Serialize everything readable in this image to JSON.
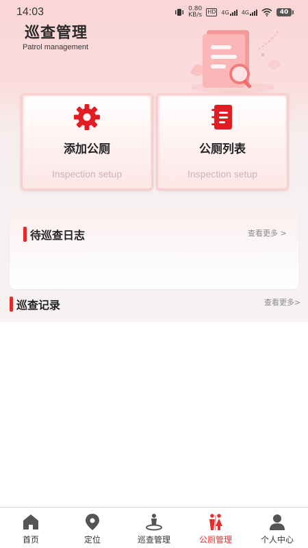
{
  "status_bar": {
    "time": "14:03",
    "speed_value": "0.80",
    "speed_unit": "KB/s",
    "hd_label": "HD",
    "net1": "4G",
    "net2": "4G",
    "battery": "40"
  },
  "header": {
    "title": "巡查管理",
    "subtitle": "Patrol management"
  },
  "cards": [
    {
      "label": "添加公厕",
      "subtitle": "Inspection setup",
      "icon": "gear-icon"
    },
    {
      "label": "公厕列表",
      "subtitle": "Inspection setup",
      "icon": "notebook-icon"
    }
  ],
  "pending_log": {
    "title": "待巡查日志",
    "more": "查看更多 >"
  },
  "records": {
    "title": "巡查记录",
    "more": "查看更多>"
  },
  "tabbar": {
    "items": [
      {
        "label": "首页",
        "icon": "home-icon"
      },
      {
        "label": "定位",
        "icon": "location-pin-icon"
      },
      {
        "label": "巡查管理",
        "icon": "patrol-person-icon"
      },
      {
        "label": "公厕管理",
        "icon": "restroom-icon",
        "active": true
      },
      {
        "label": "个人中心",
        "icon": "user-icon"
      }
    ]
  },
  "colors": {
    "accent": "#e12a2a",
    "active_tab": "#e03030",
    "card_bg": "#fde6e6",
    "hero_bg": "#fbd6d6"
  }
}
